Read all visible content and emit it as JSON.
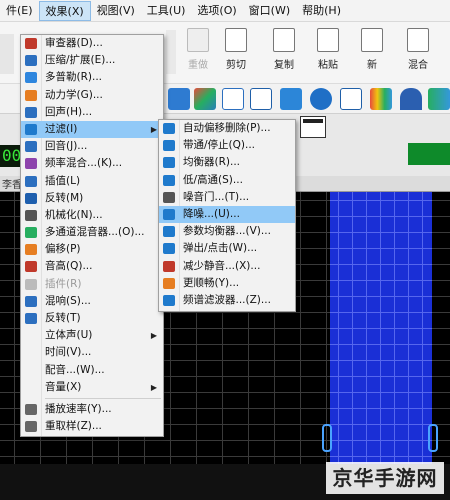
{
  "menubar": [
    {
      "label": "件(E)"
    },
    {
      "label": "效果(X)",
      "active": true
    },
    {
      "label": "视图(V)"
    },
    {
      "label": "工具(U)"
    },
    {
      "label": "选项(O)"
    },
    {
      "label": "窗口(W)"
    },
    {
      "label": "帮助(H)"
    }
  ],
  "toolbar": {
    "items": [
      {
        "label": "重做",
        "icon": "redo-icon",
        "disabled": true
      },
      {
        "label": "剪切",
        "icon": "scissors-icon"
      },
      {
        "label": "复制",
        "icon": "copy-icon"
      },
      {
        "label": "粘贴",
        "icon": "paste-icon"
      },
      {
        "label": "新",
        "icon": "new-file-icon"
      },
      {
        "label": "混合",
        "icon": "mix-icon"
      }
    ]
  },
  "led_text": "00",
  "tab_label": "李香",
  "effects_menu": {
    "items": [
      {
        "label": "审查器(D)...",
        "icon": "inspector-icon",
        "color": "#c0392b"
      },
      {
        "label": "压缩/扩展(E)...",
        "icon": "compress-icon",
        "color": "#2c6fbf"
      },
      {
        "label": "多普勒(R)...",
        "icon": "doppler-icon",
        "color": "#2e86de"
      },
      {
        "label": "动力学(G)...",
        "icon": "dynamics-icon",
        "color": "#e67e22"
      },
      {
        "label": "回声(H)...",
        "icon": "echo-icon",
        "color": "#2c6fbf"
      },
      {
        "label": "过滤(I)",
        "icon": "filter-icon",
        "color": "#1f7acc",
        "submenu": true,
        "highlight": true
      },
      {
        "label": "回音(J)...",
        "icon": "reverb-icon",
        "color": "#2c6fbf"
      },
      {
        "label": "频率混合...(K)...",
        "icon": "freq-mix-icon",
        "color": "#8e44ad"
      },
      {
        "label": "插值(L)",
        "icon": "interpolate-icon",
        "color": "#2c6fbf"
      },
      {
        "label": "反转(M)",
        "icon": "invert-icon",
        "color": "#1e5fae"
      },
      {
        "label": "机械化(N)...",
        "icon": "mechanize-icon",
        "color": "#555555"
      },
      {
        "label": "多通道混音器...(O)...",
        "icon": "multichannel-icon",
        "color": "#27ae60"
      },
      {
        "label": "偏移(P)",
        "icon": "offset-icon",
        "color": "#e67e22"
      },
      {
        "label": "音高(Q)...",
        "icon": "pitch-icon",
        "color": "#c0392b"
      },
      {
        "label": "插件(R)",
        "icon": "plugin-icon",
        "color": "#bbbbbb",
        "disabled": true
      },
      {
        "label": "混响(S)...",
        "icon": "reverb2-icon",
        "color": "#2c6fbf"
      },
      {
        "label": "反转(T)",
        "icon": "reverse-icon",
        "color": "#2c6fbf"
      },
      {
        "label": "立体声(U)",
        "icon": "stereo-icon",
        "color": "#f2f2f2",
        "submenu": true
      },
      {
        "label": "时间(V)...",
        "icon": "time-icon",
        "color": "#f2f2f2"
      },
      {
        "label": "配音...(W)...",
        "icon": "dub-icon",
        "color": "#f2f2f2"
      },
      {
        "label": "音量(X)",
        "icon": "volume-icon",
        "color": "#f2f2f2",
        "submenu": true
      },
      {
        "sep": true
      },
      {
        "label": "播放速率(Y)...",
        "icon": "playback-rate-icon",
        "color": "#666666"
      },
      {
        "label": "重取样(Z)...",
        "icon": "resample-icon",
        "color": "#666666"
      }
    ]
  },
  "filter_menu": {
    "items": [
      {
        "label": "自动偏移删除(P)...",
        "icon": "auto-dc-icon",
        "color": "#1f7acc"
      },
      {
        "label": "带通/停止(Q)...",
        "icon": "bandpass-icon",
        "color": "#1f7acc"
      },
      {
        "label": "均衡器(R)...",
        "icon": "equalizer-icon",
        "color": "#1f7acc"
      },
      {
        "label": "低/高通(S)...",
        "icon": "lowhigh-pass-icon",
        "color": "#1f7acc"
      },
      {
        "label": "噪音门...(T)...",
        "icon": "noise-gate-icon",
        "color": "#555555"
      },
      {
        "label": "降噪...(U)...",
        "icon": "noise-reduction-icon",
        "color": "#1f7acc",
        "highlight": true
      },
      {
        "label": "参数均衡器...(V)...",
        "icon": "parametric-eq-icon",
        "color": "#1f7acc"
      },
      {
        "label": "弹出/点击(W)...",
        "icon": "click-pop-icon",
        "color": "#1f7acc"
      },
      {
        "label": "减少静音...(X)...",
        "icon": "reduce-silence-icon",
        "color": "#c0392b"
      },
      {
        "label": "更顺畅(Y)...",
        "icon": "smooth-icon",
        "color": "#e67e22"
      },
      {
        "label": "频谱滤波器...(Z)...",
        "icon": "spectral-filter-icon",
        "color": "#1f7acc"
      }
    ]
  },
  "watermark": "京华手游网"
}
